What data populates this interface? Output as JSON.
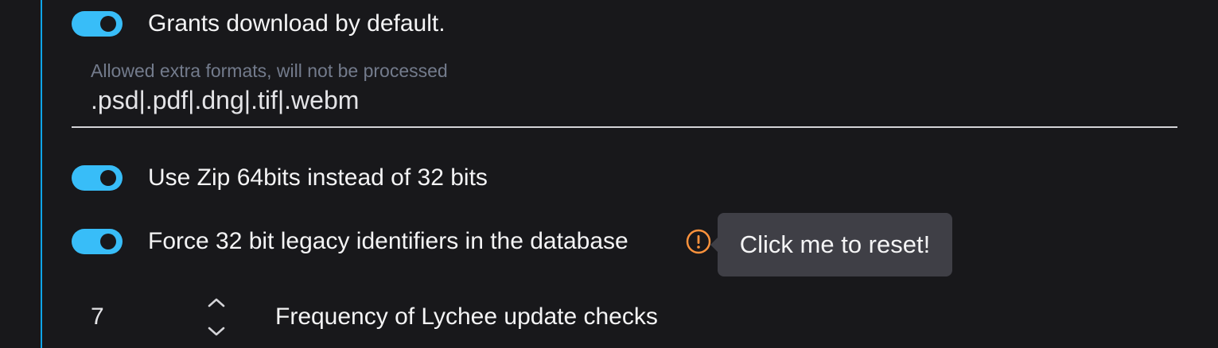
{
  "settings": {
    "grants_download": {
      "label": "Grants download by default.",
      "enabled": true
    },
    "extra_formats": {
      "label": "Allowed extra formats, will not be processed",
      "value": ".psd|.pdf|.dng|.tif|.webm"
    },
    "zip64": {
      "label": "Use Zip 64bits instead of 32 bits",
      "enabled": true
    },
    "legacy_ids": {
      "label": "Force 32 bit legacy identifiers in the database",
      "enabled": true,
      "warning_icon": "exclamation-circle-icon",
      "tooltip": "Click me to reset!"
    },
    "update_frequency": {
      "value": "7",
      "label": "Frequency of Lychee update checks"
    }
  },
  "colors": {
    "background": "#18181b",
    "accent": "#38bdf8",
    "warning": "#fb923c",
    "tooltip_bg": "#3f3f46"
  }
}
